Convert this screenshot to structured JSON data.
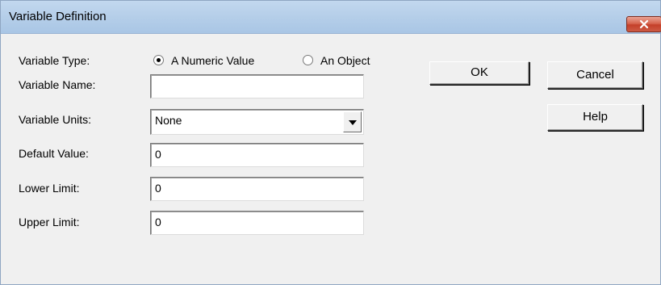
{
  "window": {
    "title": "Variable Definition"
  },
  "form": {
    "type_label": "Variable Type:",
    "radio_numeric": "A Numeric Value",
    "radio_object": "An Object",
    "selected_type": "numeric",
    "name_label": "Variable Name:",
    "name_value": "",
    "units_label": "Variable Units:",
    "units_value": "None",
    "default_label": "Default Value:",
    "default_value": "0",
    "lower_label": "Lower Limit:",
    "lower_value": "0",
    "upper_label": "Upper Limit:",
    "upper_value": "0"
  },
  "buttons": {
    "ok": "OK",
    "cancel": "Cancel",
    "help": "Help"
  },
  "icons": {
    "close": "close-icon",
    "dropdown": "chevron-down-icon"
  }
}
